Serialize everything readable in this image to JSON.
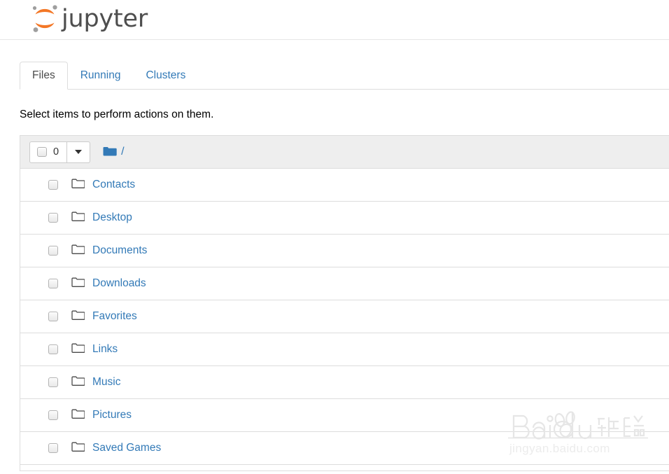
{
  "header": {
    "logo_text": "jupyter",
    "logo_icon": "jupyter-logo-icon",
    "logo_arc_color": "#f37726",
    "logo_dot_color": "#9e9e9e"
  },
  "tabs": [
    {
      "label": "Files",
      "active": true,
      "name": "tab-files"
    },
    {
      "label": "Running",
      "active": false,
      "name": "tab-running"
    },
    {
      "label": "Clusters",
      "active": false,
      "name": "tab-clusters"
    }
  ],
  "notice": "Select items to perform actions on them.",
  "toolbar": {
    "select_all_checkbox": "select-all-checkbox",
    "selected_count": "0",
    "dropdown_icon": "caret-down-icon",
    "breadcrumb_folder_icon": "folder-filled-icon",
    "breadcrumb_path": "/",
    "folder_icon_color": "#337ab7"
  },
  "files": [
    {
      "name": "Contacts",
      "icon": "folder-icon"
    },
    {
      "name": "Desktop",
      "icon": "folder-icon"
    },
    {
      "name": "Documents",
      "icon": "folder-icon"
    },
    {
      "name": "Downloads",
      "icon": "folder-icon"
    },
    {
      "name": "Favorites",
      "icon": "folder-icon"
    },
    {
      "name": "Links",
      "icon": "folder-icon"
    },
    {
      "name": "Music",
      "icon": "folder-icon"
    },
    {
      "name": "Pictures",
      "icon": "folder-icon"
    },
    {
      "name": "Saved Games",
      "icon": "folder-icon"
    }
  ],
  "watermark": {
    "brand": "Baidu",
    "brand_cn": "经验",
    "url": "jingyan.baidu.com"
  },
  "colors": {
    "link": "#337ab7",
    "toolbar_bg": "#eeeeee",
    "border": "#dddddd",
    "text": "#333333"
  }
}
